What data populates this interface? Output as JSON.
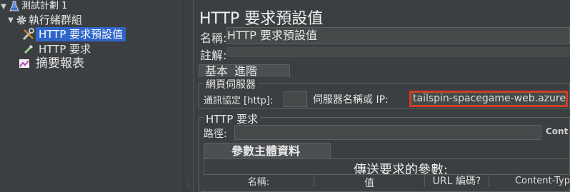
{
  "tree": {
    "items": [
      {
        "label": "測試計劃 1",
        "icon": "flask-icon"
      },
      {
        "label": "執行緒群組",
        "icon": "gear-icon"
      },
      {
        "label": "HTTP 要求預設值",
        "icon": "wrench-icon",
        "selected": true
      },
      {
        "label": "HTTP 要求",
        "icon": "pipette-icon"
      },
      {
        "label": "摘要報表",
        "icon": "chart-icon"
      }
    ]
  },
  "panel": {
    "title": "HTTP 要求預設值",
    "name_label": "名稱:",
    "name_value": "HTTP 要求預設值",
    "comment_label": "註解:",
    "tabs": [
      "基本",
      "進階"
    ],
    "web_server": {
      "group_title": "網頁伺服器",
      "protocol_label": "通訊協定 [http]:",
      "server_label": "伺服器名稱或 IP:",
      "server_value": "tailspin-spacegame-web.azurewet"
    },
    "http_request": {
      "group_title": "HTTP 要求",
      "path_label": "路徑:",
      "content_label": "Cont"
    },
    "params": {
      "tab_label": "參數主體資料",
      "heading": "傳送要求的參數:",
      "columns": [
        "名稱:",
        "值",
        "URL 編碼?",
        "Content-Typ"
      ]
    }
  }
}
